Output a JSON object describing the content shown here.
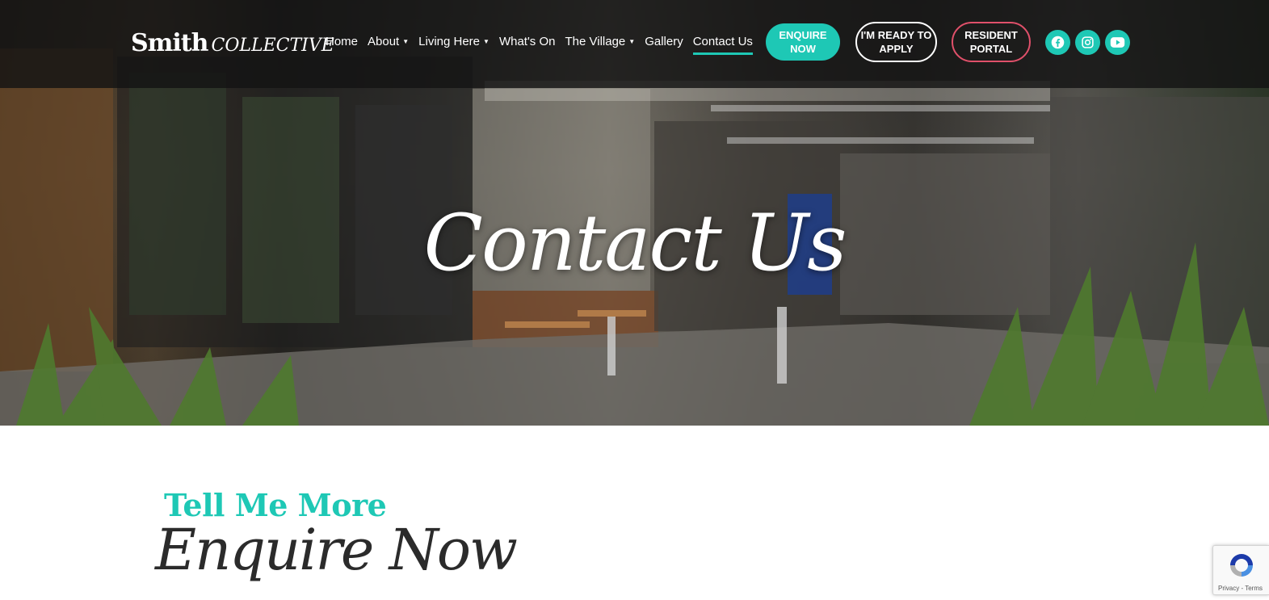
{
  "brand": {
    "name_main": "Smith",
    "name_sub": "COLLECTIVE"
  },
  "nav": {
    "items": [
      {
        "label": "Home",
        "has_caret": false,
        "active": false
      },
      {
        "label": "About",
        "has_caret": true,
        "active": false
      },
      {
        "label": "Living Here",
        "has_caret": true,
        "active": false
      },
      {
        "label": "What's On",
        "has_caret": false,
        "active": false
      },
      {
        "label": "The Village",
        "has_caret": true,
        "active": false
      },
      {
        "label": "Gallery",
        "has_caret": false,
        "active": false
      },
      {
        "label": "Contact Us",
        "has_caret": false,
        "active": true
      }
    ],
    "buttons": {
      "enquire": "ENQUIRE NOW",
      "apply": "I'M READY TO APPLY",
      "portal": "RESIDENT PORTAL"
    },
    "social": [
      "facebook-icon",
      "instagram-icon",
      "youtube-icon"
    ]
  },
  "hero": {
    "title": "Contact Us"
  },
  "content": {
    "subtitle": "Tell Me More",
    "heading": "Enquire Now"
  },
  "recaptcha": {
    "privacy": "Privacy",
    "separator": " - ",
    "terms": "Terms"
  },
  "colors": {
    "accent": "#1ec8b5",
    "portal_border": "#e0506a",
    "nav_bg": "#141414"
  }
}
